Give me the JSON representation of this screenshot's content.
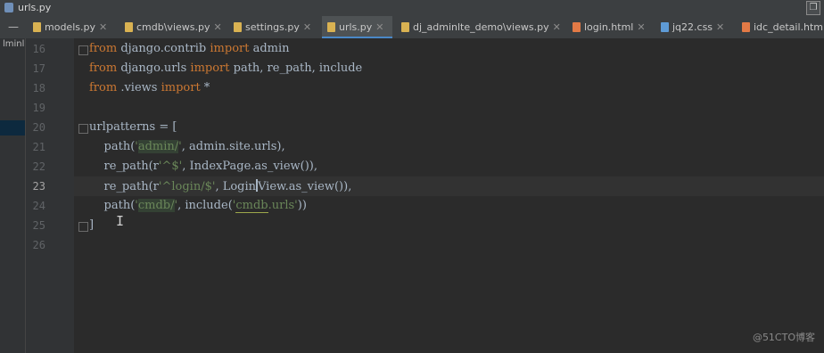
{
  "window": {
    "title": "urls.py",
    "restore_label": "❐"
  },
  "side_tab": {
    "label": "—"
  },
  "project_panel": {
    "label": "lminl"
  },
  "tabs": [
    {
      "label": "models.py",
      "icon": "python-file-icon",
      "color": "#d9b252"
    },
    {
      "label": "cmdb\\views.py",
      "icon": "python-file-icon",
      "color": "#d9b252"
    },
    {
      "label": "settings.py",
      "icon": "python-file-icon",
      "color": "#d9b252"
    },
    {
      "label": "urls.py",
      "icon": "python-file-icon",
      "color": "#d9b252",
      "active": true
    },
    {
      "label": "dj_adminlte_demo\\views.py",
      "icon": "python-file-icon",
      "color": "#d9b252"
    },
    {
      "label": "login.html",
      "icon": "html-file-icon",
      "color": "#e37a46"
    },
    {
      "label": "jq22.css",
      "icon": "css-file-icon",
      "color": "#5e9bd6"
    },
    {
      "label": "idc_detail.html",
      "icon": "html-file-icon",
      "color": "#e37a46"
    }
  ],
  "editor": {
    "line_numbers": [
      "16",
      "17",
      "18",
      "19",
      "20",
      "21",
      "22",
      "23",
      "24",
      "25",
      "26"
    ],
    "current_line": "23",
    "code": {
      "l16_a": "from",
      "l16_b": " django.contrib ",
      "l16_c": "import",
      "l16_d": " admin",
      "l17_a": "from",
      "l17_b": " django.urls ",
      "l17_c": "import",
      "l17_d": " path, re_path, include",
      "l18_a": "from",
      "l18_b": " .views ",
      "l18_c": "import",
      "l18_d": " *",
      "l20": "urlpatterns = [",
      "l21_a": "    path(",
      "l21_b": "'",
      "l21_c": "admin/",
      "l21_d": "'",
      "l21_e": ", admin.site.urls),",
      "l22_a": "    re_path(r",
      "l22_b": "'^$'",
      "l22_c": ", IndexPage.as_view()),",
      "l23_a": "    re_path(r",
      "l23_b": "'^login/$'",
      "l23_c": ", Login",
      "l23_d": "View.as_view()),",
      "l24_a": "    path(",
      "l24_b": "'",
      "l24_c": "cmdb/",
      "l24_d": "'",
      "l24_e": ", include(",
      "l24_f": "'",
      "l24_g": "cmdb",
      "l24_h": ".urls'",
      "l24_i": "))",
      "l25": "]"
    }
  },
  "watermark": "@51CTO博客"
}
